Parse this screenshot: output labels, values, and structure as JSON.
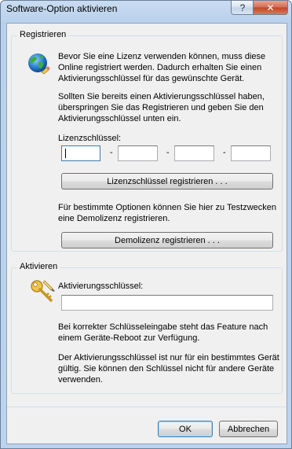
{
  "window": {
    "title": "Software-Option aktivieren",
    "help_label": "?",
    "close_label": "✕"
  },
  "register": {
    "group_label": "Registrieren",
    "intro_text": "Bevor Sie eine Lizenz verwenden können, muss diese Online registriert werden. Dadurch erhalten Sie einen Aktivierungsschlüssel für das gewünschte Gerät.",
    "skip_text": "Sollten Sie bereits einen Aktivierungsschlüssel haben, überspringen Sie das Registrieren und geben Sie den Aktivierungsschlüssel unten ein.",
    "license_key_label": "Lizenzschlüssel:",
    "key_parts": [
      "",
      "",
      "",
      ""
    ],
    "separator": "-",
    "register_button": "Lizenzschlüssel registrieren . . .",
    "demo_text": "Für bestimmte Optionen können Sie hier zu Testzwecken eine Demolizenz registrieren.",
    "demo_button": "Demolizenz registrieren . . ."
  },
  "activate": {
    "group_label": "Aktivieren",
    "activation_key_label": "Aktivierungsschlüssel:",
    "activation_key_value": "",
    "reboot_text": "Bei korrekter Schlüsseleingabe steht das Feature nach einem Geräte-Reboot zur Verfügung.",
    "device_text": "Der Aktivierungsschlüssel ist nur für ein bestimmtes Gerät gültig. Sie können den Schlüssel nicht für andere Geräte verwenden."
  },
  "footer": {
    "ok_label": "OK",
    "cancel_label": "Abbrechen"
  },
  "icons": {
    "globe": "globe-icon",
    "key": "key-icon"
  }
}
